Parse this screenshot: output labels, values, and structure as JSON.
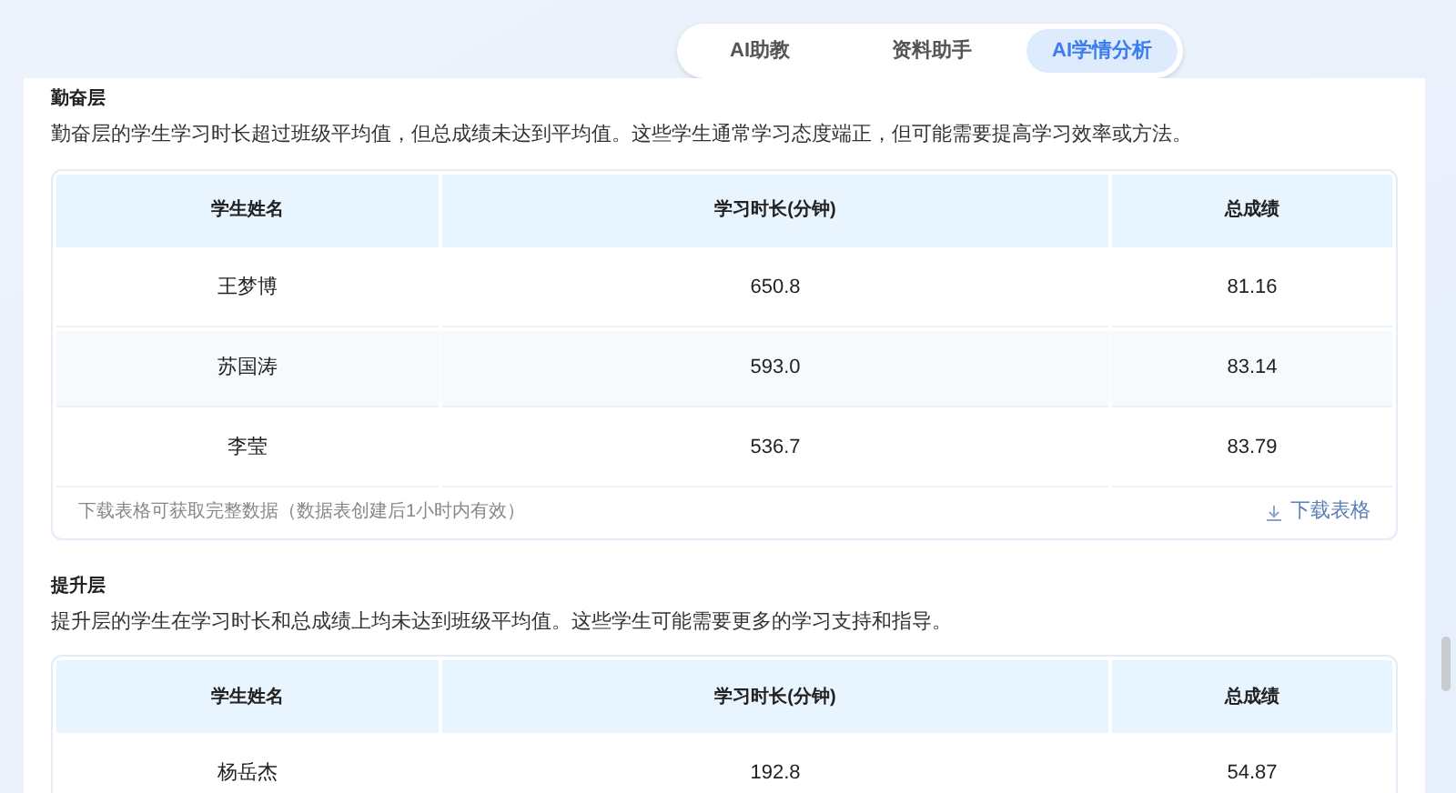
{
  "tabs": [
    {
      "label": "AI助教",
      "selected": false
    },
    {
      "label": "资料助手",
      "selected": false
    },
    {
      "label": "AI学情分析",
      "selected": true
    }
  ],
  "sections": [
    {
      "title": "勤奋层",
      "description": "勤奋层的学生学习时长超过班级平均值，但总成绩未达到平均值。这些学生通常学习态度端正，但可能需要提高学习效率或方法。",
      "columns": [
        "学生姓名",
        "学习时长(分钟)",
        "总成绩"
      ],
      "rows": [
        [
          "王梦博",
          "650.8",
          "81.16"
        ],
        [
          "苏国涛",
          "593.0",
          "83.14"
        ],
        [
          "李莹",
          "536.7",
          "83.79"
        ]
      ],
      "footer": {
        "note": "下载表格可获取完整数据（数据表创建后1小时内有效）",
        "download": "下载表格"
      }
    },
    {
      "title": "提升层",
      "description": "提升层的学生在学习时长和总成绩上均未达到班级平均值。这些学生可能需要更多的学习支持和指导。",
      "columns": [
        "学生姓名",
        "学习时长(分钟)",
        "总成绩"
      ],
      "rows": [
        [
          "杨岳杰",
          "192.8",
          "54.87"
        ]
      ]
    }
  ]
}
